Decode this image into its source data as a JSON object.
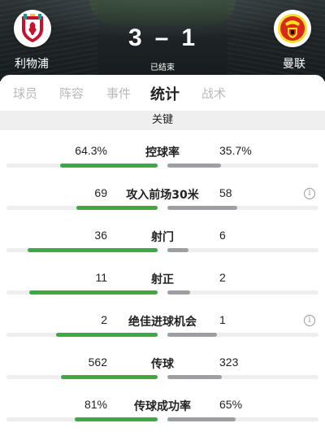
{
  "match": {
    "home_team": "利物浦",
    "away_team": "曼联",
    "home_score": "3",
    "away_score": "1",
    "separator": "–",
    "status": "已结束"
  },
  "tabs": [
    {
      "label": "球员",
      "active": false
    },
    {
      "label": "阵容",
      "active": false
    },
    {
      "label": "事件",
      "active": false
    },
    {
      "label": "统计",
      "active": true
    },
    {
      "label": "战术",
      "active": false
    }
  ],
  "section": {
    "title": "关键"
  },
  "stats": [
    {
      "label": "控球率",
      "home": "64.3%",
      "away": "35.7%",
      "home_share": 0.643,
      "away_share": 0.357,
      "info": false
    },
    {
      "label": "攻入前场30米",
      "home": "69",
      "away": "58",
      "home_share": 0.54,
      "away_share": 0.46,
      "info": true
    },
    {
      "label": "射门",
      "home": "36",
      "away": "6",
      "home_share": 0.86,
      "away_share": 0.14,
      "info": false
    },
    {
      "label": "射正",
      "home": "11",
      "away": "2",
      "home_share": 0.85,
      "away_share": 0.15,
      "info": false
    },
    {
      "label": "绝佳进球机会",
      "home": "2",
      "away": "1",
      "home_share": 0.67,
      "away_share": 0.33,
      "info": true
    },
    {
      "label": "传球",
      "home": "562",
      "away": "323",
      "home_share": 0.64,
      "away_share": 0.36,
      "info": false
    },
    {
      "label": "传球成功率",
      "home": "81%",
      "away": "65%",
      "home_share": 0.55,
      "away_share": 0.45,
      "info": false
    }
  ],
  "icons": {
    "home_crest": "liverpool-crest-icon",
    "away_crest": "manchester-united-crest-icon",
    "info": "info-icon"
  },
  "colors": {
    "home_bar": "#3aaa48",
    "away_bar": "#9d9fa2",
    "liverpool_red": "#c8102e",
    "united_red": "#da291c",
    "united_yellow": "#fbe122"
  }
}
